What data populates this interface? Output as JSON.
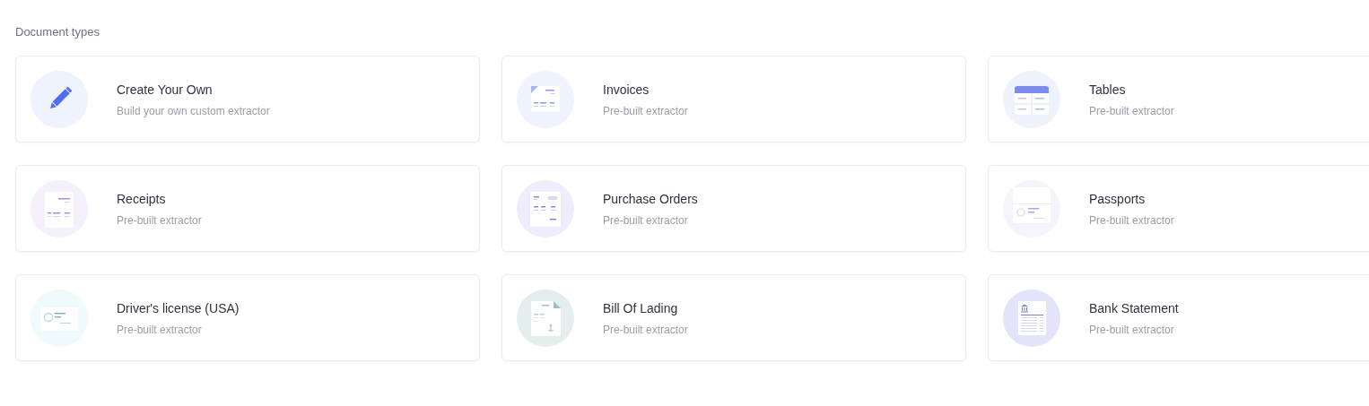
{
  "section_title": "Document types",
  "cards": [
    {
      "kind": "pencil",
      "title": "Create Your Own",
      "subtitle": "Build your own custom extractor"
    },
    {
      "kind": "invoice",
      "title": "Invoices",
      "subtitle": "Pre-built extractor"
    },
    {
      "kind": "table",
      "title": "Tables",
      "subtitle": "Pre-built extractor"
    },
    {
      "kind": "receipt",
      "title": "Receipts",
      "subtitle": "Pre-built extractor"
    },
    {
      "kind": "purchase_order",
      "title": "Purchase Orders",
      "subtitle": "Pre-built extractor"
    },
    {
      "kind": "passport",
      "title": "Passports",
      "subtitle": "Pre-built extractor"
    },
    {
      "kind": "id_card",
      "title": "Driver's license (USA)",
      "subtitle": "Pre-built extractor"
    },
    {
      "kind": "bill",
      "title": "Bill Of Lading",
      "subtitle": "Pre-built extractor"
    },
    {
      "kind": "bank",
      "title": "Bank Statement",
      "subtitle": "Pre-built extractor"
    }
  ]
}
